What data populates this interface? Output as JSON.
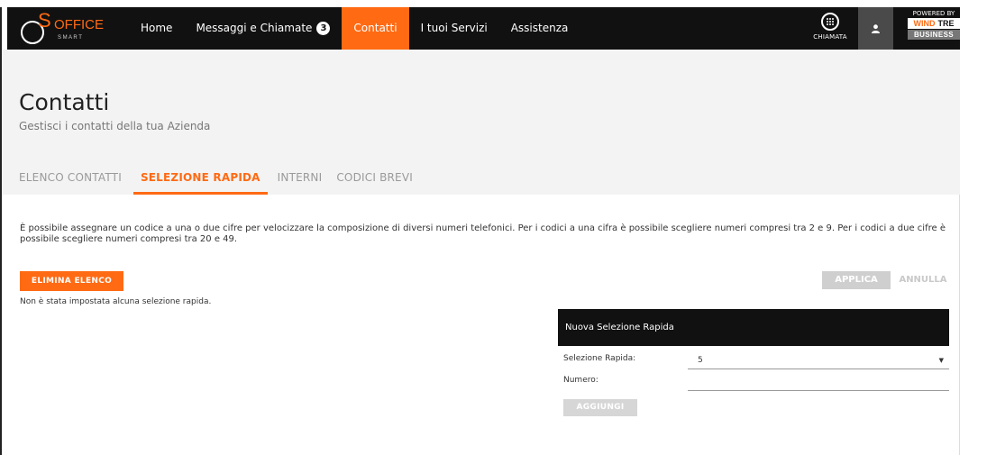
{
  "brand": {
    "logo_main": "OFFICE",
    "logo_sub": "S M A R T",
    "logo_letter": "S",
    "accent": "#ff6a13"
  },
  "nav": {
    "items": [
      {
        "label": "Home"
      },
      {
        "label": "Messaggi e Chiamate",
        "badge": "3"
      },
      {
        "label": "Contatti"
      },
      {
        "label": "I tuoi Servizi"
      },
      {
        "label": "Assistenza"
      }
    ],
    "active": "Contatti",
    "call_label": "CHIAMATA",
    "powered_by": "POWERED BY",
    "partner_wind": "WIND",
    "partner_tre": "TRE",
    "partner_business": "BUSINESS"
  },
  "page": {
    "title": "Contatti",
    "subtitle": "Gestisci i contatti della tua Azienda"
  },
  "tabs": [
    {
      "label": "ELENCO CONTATTI"
    },
    {
      "label": "SELEZIONE RAPIDA"
    },
    {
      "label": "INTERNI"
    },
    {
      "label": "CODICI BREVI"
    }
  ],
  "content": {
    "description": "È possibile assegnare un codice a una o due cifre per velocizzare la composizione di diversi numeri telefonici. Per i codici a una cifra è possibile scegliere numeri compresi tra 2 e 9. Per i codici a due cifre è possibile scegliere numeri compresi tra 20 e 49.",
    "delete_list": "ELIMINA ELENCO",
    "empty_note": "Non è stata impostata alcuna selezione rapida.",
    "apply": "APPLICA",
    "cancel": "ANNULLA"
  },
  "panel": {
    "title": "Nuova Selezione Rapida",
    "speed_dial_label": "Selezione Rapida:",
    "speed_dial_value": "5",
    "number_label": "Numero:",
    "number_value": "",
    "add": "AGGIUNGI"
  }
}
